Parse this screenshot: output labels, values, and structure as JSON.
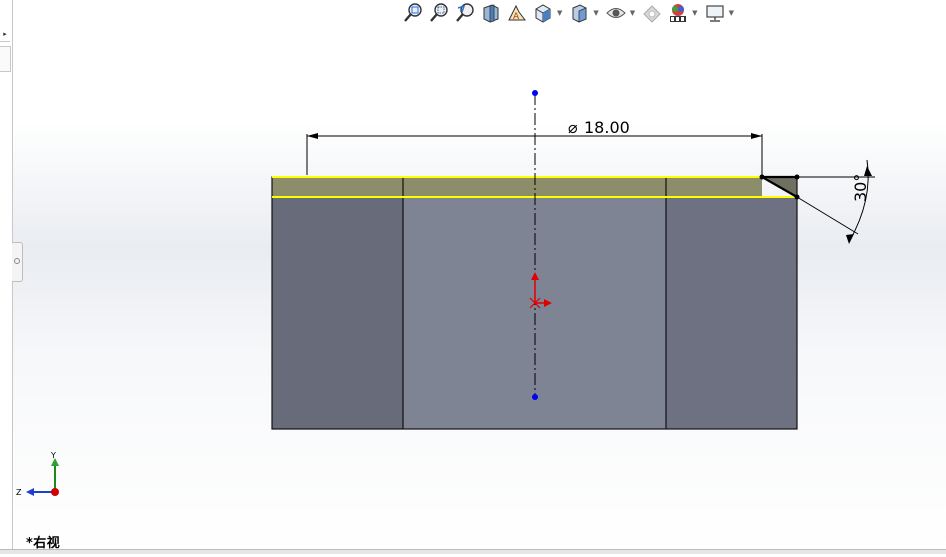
{
  "toolbar": {
    "buttons": [
      {
        "name": "zoom-to-fit-icon",
        "has_dropdown": false
      },
      {
        "name": "zoom-to-area-icon",
        "has_dropdown": false
      },
      {
        "name": "previous-view-icon",
        "has_dropdown": false
      },
      {
        "name": "section-view-icon",
        "has_dropdown": false
      },
      {
        "name": "dynamic-annotation-views-icon",
        "has_dropdown": false
      },
      {
        "name": "view-orientation-icon",
        "has_dropdown": true
      },
      {
        "name": "display-style-icon",
        "has_dropdown": true
      },
      {
        "name": "hide-show-items-icon",
        "has_dropdown": true
      },
      {
        "name": "edit-appearance-icon",
        "has_dropdown": false
      },
      {
        "name": "apply-scene-icon",
        "has_dropdown": true
      },
      {
        "name": "view-settings-icon",
        "has_dropdown": true
      }
    ]
  },
  "sketch": {
    "diameter_dimension": "18.00",
    "diameter_symbol": "⌀",
    "angle_dimension": "30°"
  },
  "triad": {
    "y_label": "Y",
    "z_label": "Z"
  },
  "view_name": "*右视",
  "colors": {
    "body_dark": "#676b7a",
    "body_light": "#7e8494",
    "chamfer_face": "#8c8d6a",
    "edge_highlight": "#ffff00",
    "centerline_point": "#0000ff",
    "origin": "#ff0000"
  }
}
